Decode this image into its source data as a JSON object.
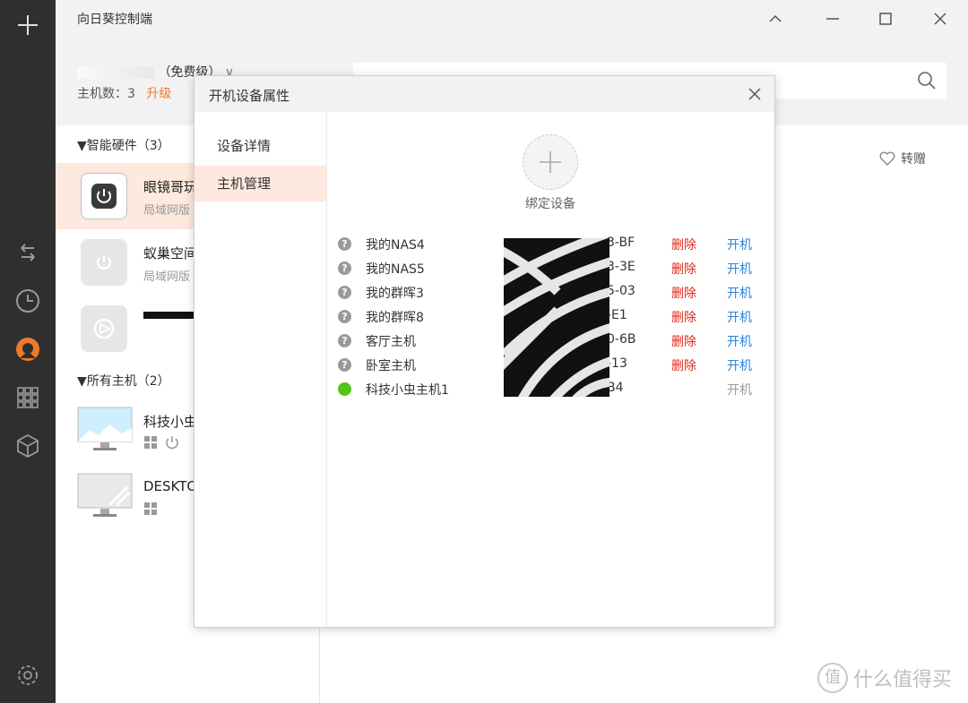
{
  "app": {
    "title": "向日葵控制端"
  },
  "account": {
    "tier_label": "（免费级）",
    "host_count_label": "主机数：3",
    "upgrade_label": "升级"
  },
  "groups": [
    {
      "title": "▼智能硬件（3）",
      "items": [
        {
          "name": "眼镜哥玩",
          "sub": "局域网版"
        },
        {
          "name": "蚁巢空间",
          "sub": "局域网版"
        },
        {
          "name": "",
          "sub": ""
        }
      ]
    },
    {
      "title": "▼所有主机（2）",
      "items": [
        {
          "name": "科技小虫"
        },
        {
          "name": "DESKTO"
        }
      ]
    }
  ],
  "content": {
    "gift_label": "转赠"
  },
  "dialog": {
    "title": "开机设备属性",
    "nav": [
      "设备详情",
      "主机管理"
    ],
    "bind_label": "绑定设备",
    "devices": [
      {
        "name": "我的NAS4",
        "mac_tail": "3-BF",
        "delete": "删除",
        "power": "开机",
        "online": false
      },
      {
        "name": "我的NAS5",
        "mac_tail": "3-3E",
        "delete": "删除",
        "power": "开机",
        "online": false
      },
      {
        "name": "我的群晖3",
        "mac_tail": "5-03",
        "delete": "删除",
        "power": "开机",
        "online": false
      },
      {
        "name": "我的群晖8",
        "mac_tail": "-E1",
        "delete": "删除",
        "power": "开机",
        "online": false
      },
      {
        "name": "客厅主机",
        "mac_tail": "0-6B",
        "delete": "删除",
        "power": "开机",
        "online": false
      },
      {
        "name": "卧室主机",
        "mac_tail": "-13",
        "delete": "删除",
        "power": "开机",
        "online": false
      },
      {
        "name": "科技小虫主机1",
        "mac_tail": "B4",
        "delete": "",
        "power": "开机",
        "online": true
      }
    ]
  },
  "watermark": {
    "text": "什么值得买",
    "logo": "值"
  },
  "colors": {
    "accent": "#f07a2a",
    "link": "#2a84d8",
    "danger": "#e0281b",
    "online": "#52c41a",
    "rail": "#2f2f2f",
    "selected_bg": "#fde9dd"
  }
}
